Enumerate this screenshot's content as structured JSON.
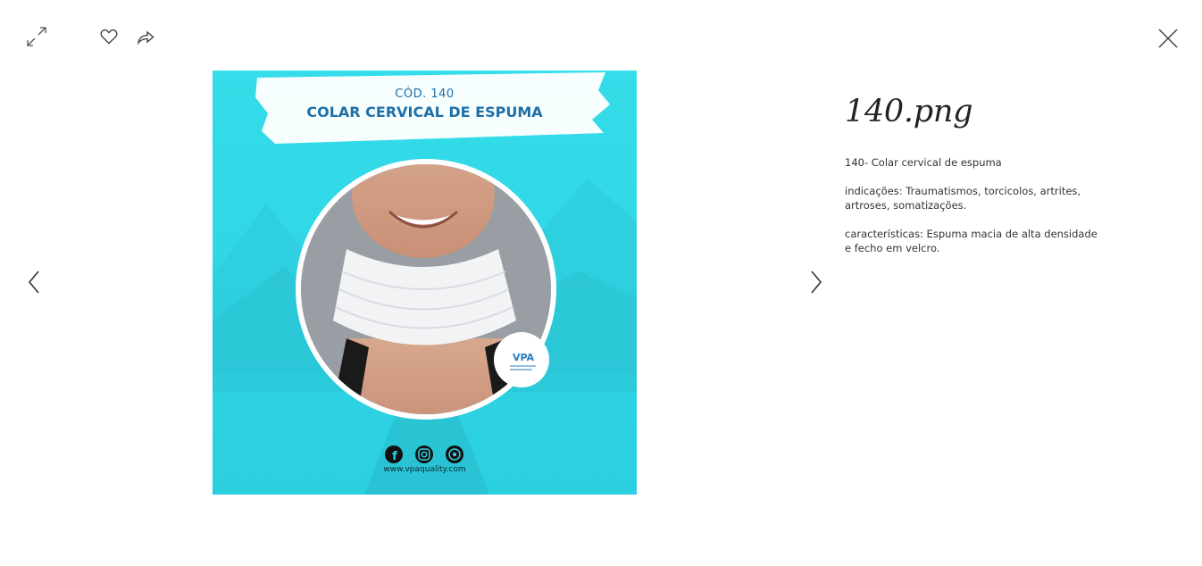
{
  "toolbar": {
    "expand_icon": "expand-icon",
    "like_icon": "heart-icon",
    "share_icon": "share-icon",
    "close_icon": "close-icon"
  },
  "navigation": {
    "prev_icon": "chevron-left-icon",
    "next_icon": "chevron-right-icon"
  },
  "media": {
    "code": "CÓD. 140",
    "product_title": "COLAR CERVICAL DE ESPUMA",
    "website": "www.vpaquality.com",
    "logo_text": "VPA",
    "social_icons": [
      "facebook-icon",
      "instagram-icon",
      "whatsapp-icon"
    ],
    "background_color": "#2fd6e4"
  },
  "info": {
    "title": "140.png",
    "description": [
      "140- Colar cervical de espuma",
      "indicações: Traumatismos, torcicolos, artrites, artroses, somatizações.",
      "características: Espuma macia de alta densidade e fecho em velcro."
    ]
  }
}
